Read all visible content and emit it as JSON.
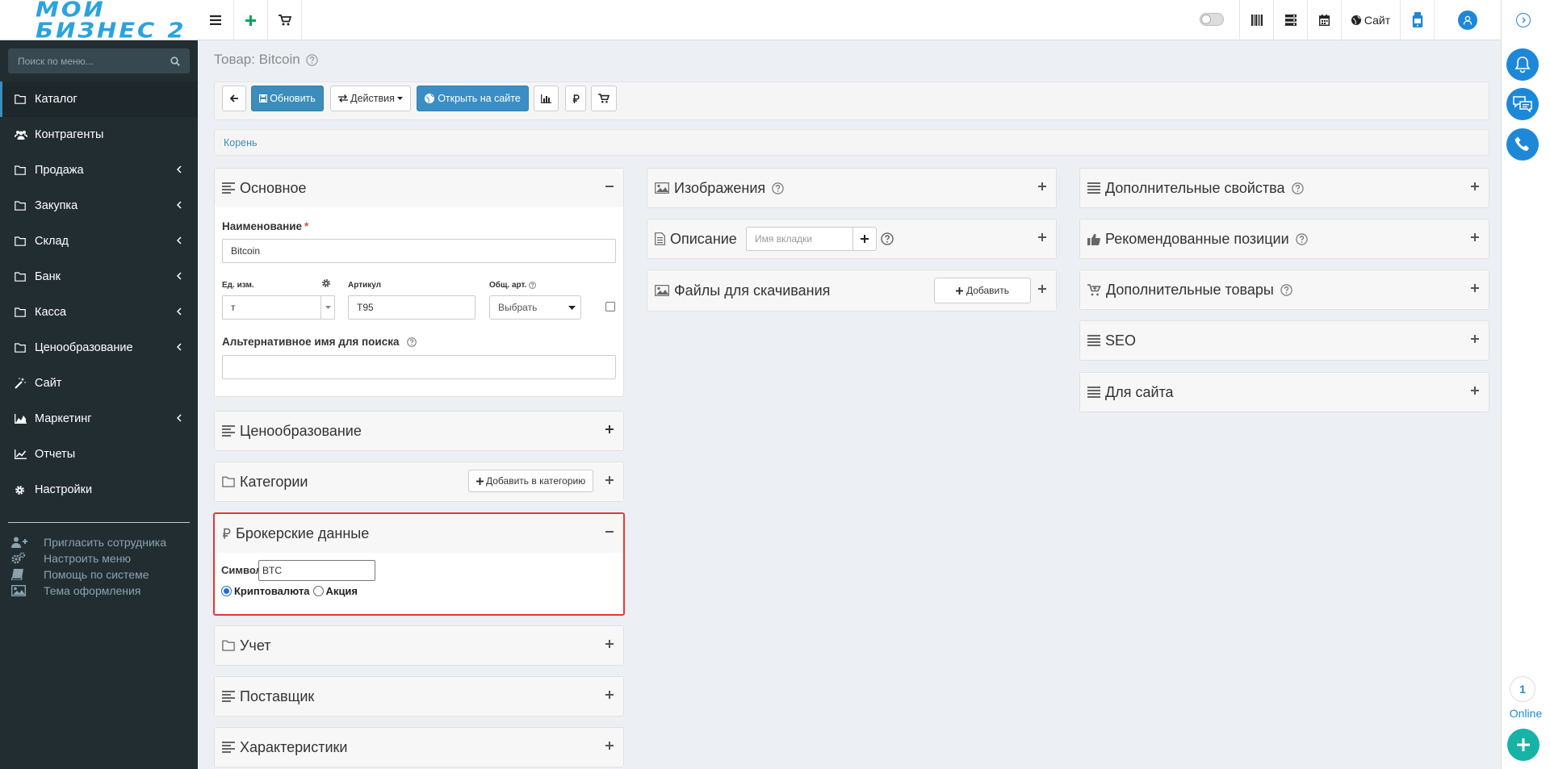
{
  "logo": {
    "text": "МОЙ БИЗНЕС 2"
  },
  "topbar": {
    "site_label": "Сайт"
  },
  "sidebar": {
    "search_placeholder": "Поиск по меню...",
    "items": [
      {
        "label": "Каталог",
        "icon": "folder-icon",
        "active": true,
        "has_children": false
      },
      {
        "label": "Контрагенты",
        "icon": "users-icon",
        "active": false,
        "has_children": false
      },
      {
        "label": "Продажа",
        "icon": "folder-icon",
        "active": false,
        "has_children": true
      },
      {
        "label": "Закупка",
        "icon": "folder-icon",
        "active": false,
        "has_children": true
      },
      {
        "label": "Склад",
        "icon": "folder-icon",
        "active": false,
        "has_children": true
      },
      {
        "label": "Банк",
        "icon": "folder-icon",
        "active": false,
        "has_children": true
      },
      {
        "label": "Касса",
        "icon": "folder-icon",
        "active": false,
        "has_children": true
      },
      {
        "label": "Ценообразование",
        "icon": "folder-icon",
        "active": false,
        "has_children": true
      },
      {
        "label": "Сайт",
        "icon": "magic-wand-icon",
        "active": false,
        "has_children": false
      },
      {
        "label": "Маркетинг",
        "icon": "area-chart-icon",
        "active": false,
        "has_children": true
      },
      {
        "label": "Отчеты",
        "icon": "line-chart-icon",
        "active": false,
        "has_children": false
      },
      {
        "label": "Настройки",
        "icon": "gear-icon",
        "active": false,
        "has_children": false
      }
    ],
    "links": [
      {
        "label": "Пригласить сотрудника",
        "icon": "user-plus-icon"
      },
      {
        "label": "Настроить меню",
        "icon": "gears-icon"
      },
      {
        "label": "Помощь по системе",
        "icon": "book-icon"
      },
      {
        "label": "Тема оформления",
        "icon": "image-icon"
      }
    ]
  },
  "page": {
    "title": "Товар: Bitcoin",
    "toolbar": {
      "update": "Обновить",
      "actions": "Действия",
      "open_site": "Открыть на сайте"
    },
    "breadcrumb": "Корень"
  },
  "panels": {
    "basic": {
      "title": "Основное",
      "name_label": "Наименование",
      "name_value": "Bitcoin",
      "unit_label": "Ед. изм.",
      "unit_value": "т",
      "sku_label": "Артикул",
      "sku_value": "T95",
      "common_sku_label": "Общ. арт.",
      "common_sku_value": "Выбрать",
      "alt_name_label": "Альтернативное имя для поиска",
      "alt_name_value": ""
    },
    "pricing": {
      "title": "Ценообразование"
    },
    "categories": {
      "title": "Категории",
      "add_button": "Добавить в категорию"
    },
    "broker": {
      "title": "Брокерские данные",
      "symbol_label": "Символ",
      "symbol_value": "BTC",
      "radio_crypto": "Криптовалюта",
      "radio_stock": "Акция"
    },
    "accounting": {
      "title": "Учет"
    },
    "supplier": {
      "title": "Поставщик"
    },
    "characteristics": {
      "title": "Характеристики"
    },
    "images": {
      "title": "Изображения"
    },
    "description": {
      "title": "Описание",
      "tab_placeholder": "Имя вкладки"
    },
    "downloads": {
      "title": "Файлы для скачивания",
      "add_button": "Добавить"
    },
    "extra_props": {
      "title": "Дополнительные свойства"
    },
    "recommended": {
      "title": "Рекомендованные позиции"
    },
    "extra_goods": {
      "title": "Дополнительные товары"
    },
    "seo": {
      "title": "SEO"
    },
    "for_site": {
      "title": "Для сайта"
    }
  },
  "rail": {
    "online_count": "1",
    "online_label": "Online"
  },
  "colors": {
    "sidebar": "#222d32",
    "primary": "#3c8dbc",
    "accent": "#1e88d8",
    "highlight": "#e53935",
    "add_green": "#00a65a"
  }
}
